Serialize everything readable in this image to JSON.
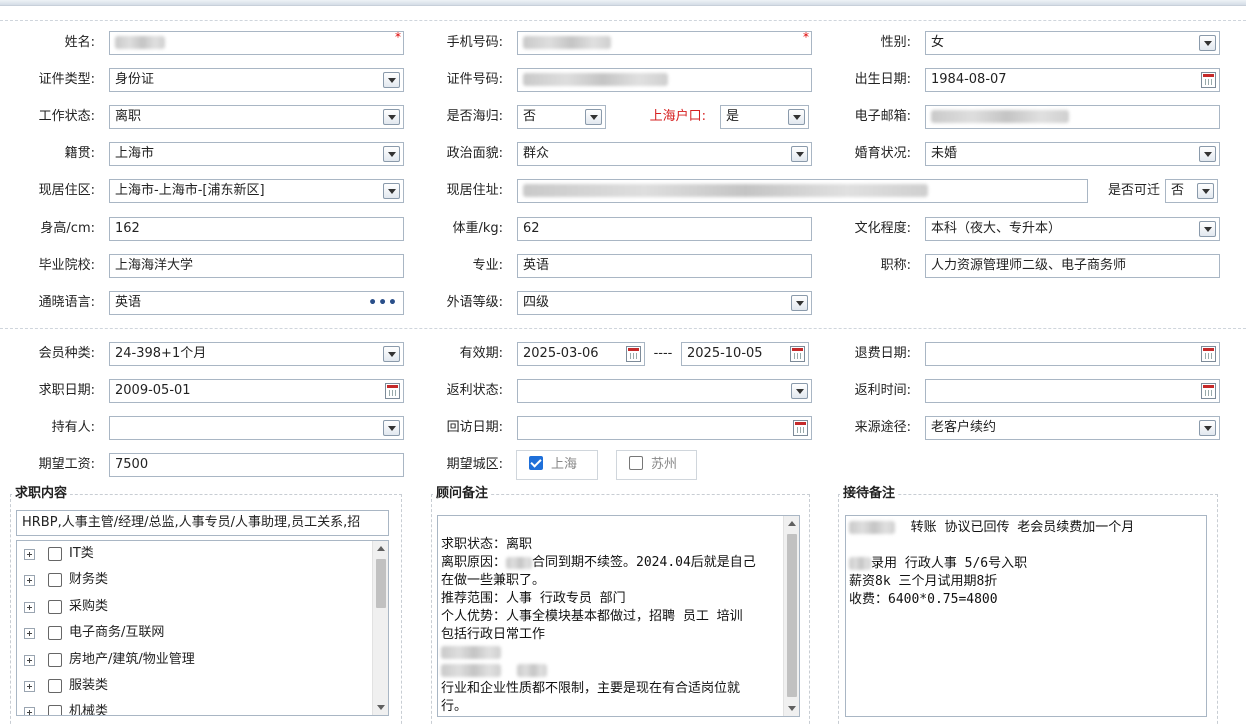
{
  "form": {
    "name_label": "姓名:",
    "phone_label": "手机号码:",
    "gender_label": "性别:",
    "gender_value": "女",
    "id_type_label": "证件类型:",
    "id_type_value": "身份证",
    "id_number_label": "证件号码:",
    "birth_label": "出生日期:",
    "birth_value": "1984-08-07",
    "work_status_label": "工作状态:",
    "work_status_value": "离职",
    "returnee_label": "是否海归:",
    "returnee_value": "否",
    "shanghai_hukou_label": "上海户口:",
    "shanghai_hukou_value": "是",
    "email_label": "电子邮箱:",
    "native_label": "籍贯:",
    "native_value": "上海市",
    "political_label": "政治面貌:",
    "political_value": "群众",
    "marital_label": "婚育状况:",
    "marital_value": "未婚",
    "residence_area_label": "现居住区:",
    "residence_area_value": "上海市-上海市-[浦东新区]",
    "residence_address_label": "现居住址:",
    "relocate_label": "是否可迁",
    "relocate_value": "否",
    "height_label": "身高/cm:",
    "height_value": "162",
    "weight_label": "体重/kg:",
    "weight_value": "62",
    "education_label": "文化程度:",
    "education_value": "本科（夜大、专升本）",
    "school_label": "毕业院校:",
    "school_value": "上海海洋大学",
    "major_label": "专业:",
    "major_value": "英语",
    "title_label": "职称:",
    "title_value": "人力资源管理师二级、电子商务师",
    "language_label": "通晓语言:",
    "language_value": "英语",
    "foreign_level_label": "外语等级:",
    "foreign_level_value": "四级",
    "member_type_label": "会员种类:",
    "member_type_value": "24-398+1个月",
    "valid_label": "有效期:",
    "valid_from": "2025-03-06",
    "valid_sep": "----",
    "valid_to": "2025-10-05",
    "refund_date_label": "退费日期:",
    "job_date_label": "求职日期:",
    "job_date_value": "2009-05-01",
    "rebate_status_label": "返利状态:",
    "rebate_time_label": "返利时间:",
    "holder_label": "持有人:",
    "revisit_label": "回访日期:",
    "source_label": "来源途径:",
    "source_value": "老客户续约",
    "salary_label": "期望工资:",
    "salary_value": "7500",
    "city_label": "期望城区:",
    "city_shanghai": "上海",
    "city_suzhou": "苏州",
    "required_mark": "*"
  },
  "job_content": {
    "legend": "求职内容",
    "summary": "HRBP,人事主管/经理/总监,人事专员/人事助理,员工关系,招",
    "categories": [
      "IT类",
      "财务类",
      "采购类",
      "电子商务/互联网",
      "房地产/建筑/物业管理",
      "服装类",
      "机械类"
    ]
  },
  "advisor_notes": {
    "legend": "顾问备注",
    "lines": [
      "",
      "求职状态：离职",
      "离职原因：",
      "合同到期不续签。2024.04后就是自己",
      "在做一些兼职了。",
      "推荐范围：人事 行政专员 部门",
      "个人优势：人事全模块基本都做过，招聘 员工 培训",
      "包括行政日常工作",
      "",
      "",
      "行业和企业性质都不限制，主要是现在有合适岗位就",
      "行。"
    ]
  },
  "reception_notes": {
    "legend": "接待备注",
    "line1": "转账 协议已回传  老会员续费加一个月",
    "line2": "",
    "line3": "录用 行政人事  5/6号入职",
    "line4": "薪资8k  三个月试用期8折",
    "line5": "收费：6400*0.75=4800"
  },
  "colors": {
    "field_border": "#a9b6c4",
    "accent_red": "#d62020",
    "checkbox_blue": "#1e6fd9"
  }
}
